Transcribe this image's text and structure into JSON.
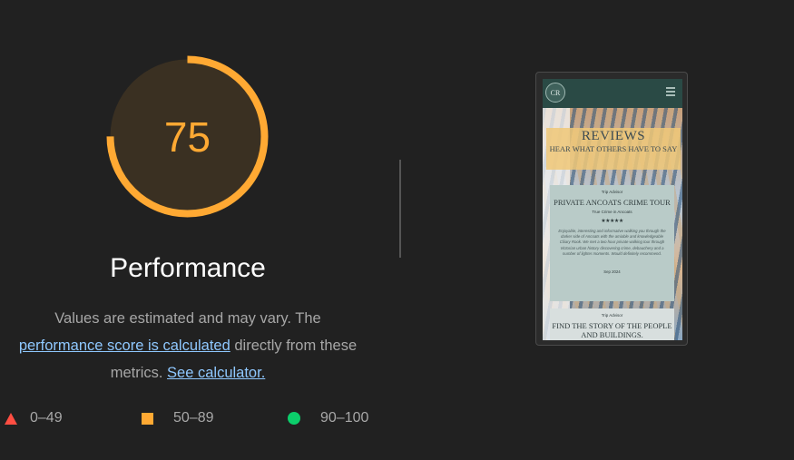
{
  "gauge": {
    "score": "75",
    "score_fraction": 0.75,
    "title": "Performance",
    "color": "#ffa933"
  },
  "description": {
    "text1": "Values are estimated and may vary. The",
    "link1": "performance score is calculated",
    "text2": " directly from these metrics. ",
    "link2": "See calculator."
  },
  "legend": [
    {
      "range": "0–49",
      "shape": "triangle",
      "color": "#ff4e42"
    },
    {
      "range": "50–89",
      "shape": "square",
      "color": "#ffa933"
    },
    {
      "range": "90–100",
      "shape": "circle",
      "color": "#0cce6b"
    }
  ],
  "thumbnail": {
    "logo": "CR",
    "icon": "hamburger-menu-icon",
    "heading": "REVIEWS",
    "subheading": "HEAR WHAT OTHERS HAVE TO SAY",
    "card1": {
      "source": "Trip Advisor",
      "title": "PRIVATE ANCOATS CRIME TOUR",
      "subtitle": "True Crime in Ancoats",
      "stars": "★★★★★",
      "body": "Enjoyable, interesting and informative walking you through the darker side of Ancoats with the amiable and knowledgeable Cliiary Rook. We met a two hour private walking tour through Victorian urban history discovering crime, debauchery and a number of lighter moments. Would definitely recommend.",
      "date": "Sep 2024"
    },
    "card2": {
      "source": "Trip Advisor",
      "title": "FIND THE STORY OF THE PEOPLE AND BUILDINGS."
    }
  }
}
